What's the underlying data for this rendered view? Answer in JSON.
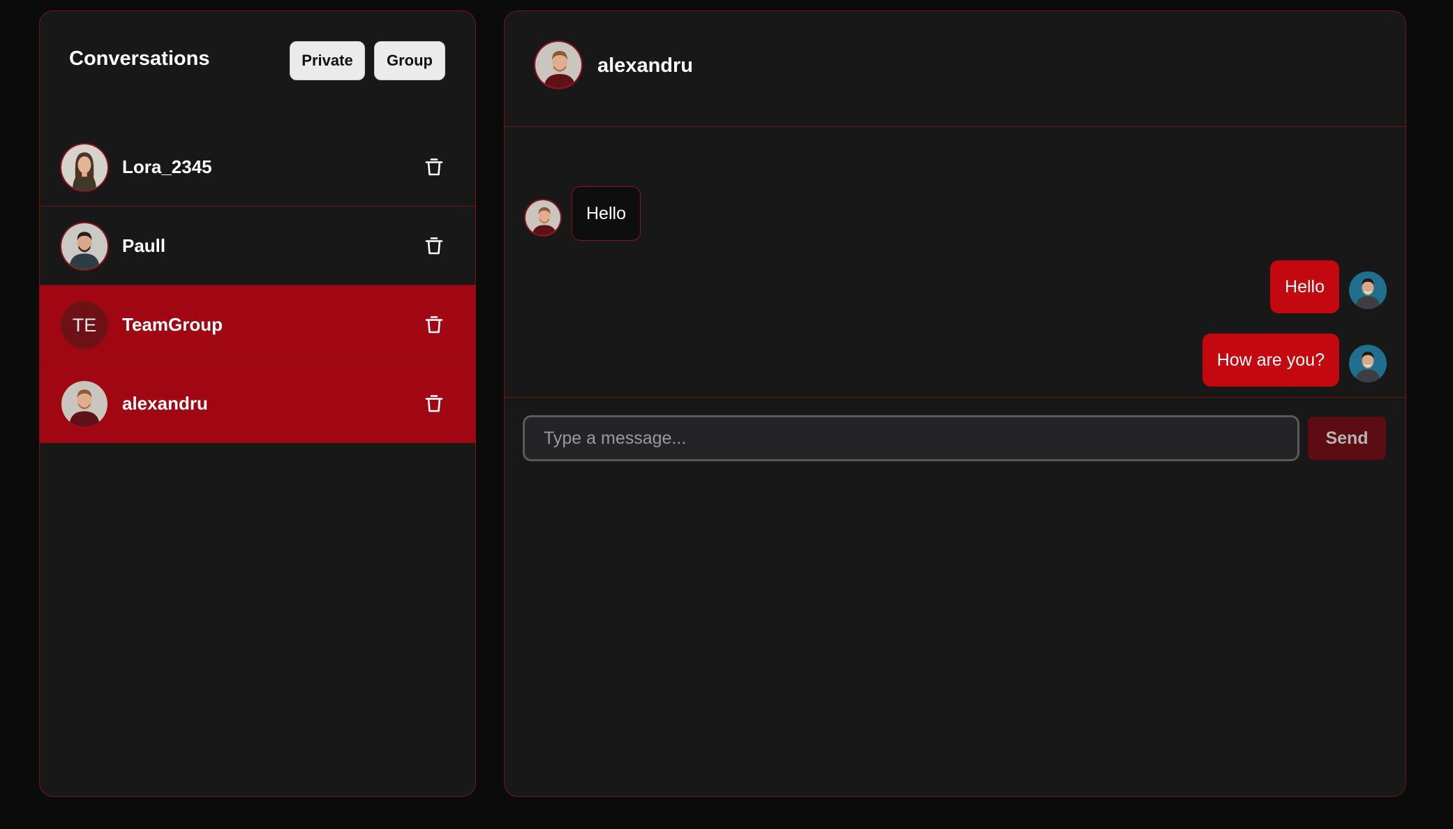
{
  "sidebar": {
    "title": "Conversations",
    "private_label": "Private",
    "group_label": "Group",
    "conversations": [
      {
        "name": "Lora_2345",
        "avatar": "photo",
        "active": false
      },
      {
        "name": "Paull",
        "avatar": "photo",
        "active": false
      },
      {
        "name": "TeamGroup",
        "avatar": "initials",
        "initials": "TE",
        "active": true
      },
      {
        "name": "alexandru",
        "avatar": "photo",
        "active": true
      }
    ]
  },
  "chat": {
    "contact_name": "alexandru",
    "messages": [
      {
        "text": "Hello",
        "direction": "incoming"
      },
      {
        "text": "Hello",
        "direction": "outgoing"
      },
      {
        "text": "How are you?",
        "direction": "outgoing"
      }
    ],
    "input_placeholder": "Type a message...",
    "send_label": "Send"
  },
  "colors": {
    "accent": "#c40810",
    "active_row": "#a10712",
    "panel_bg": "#181819",
    "border": "#7a1218"
  },
  "icons": [
    "trash-icon",
    "avatar-photo",
    "avatar-initials"
  ]
}
